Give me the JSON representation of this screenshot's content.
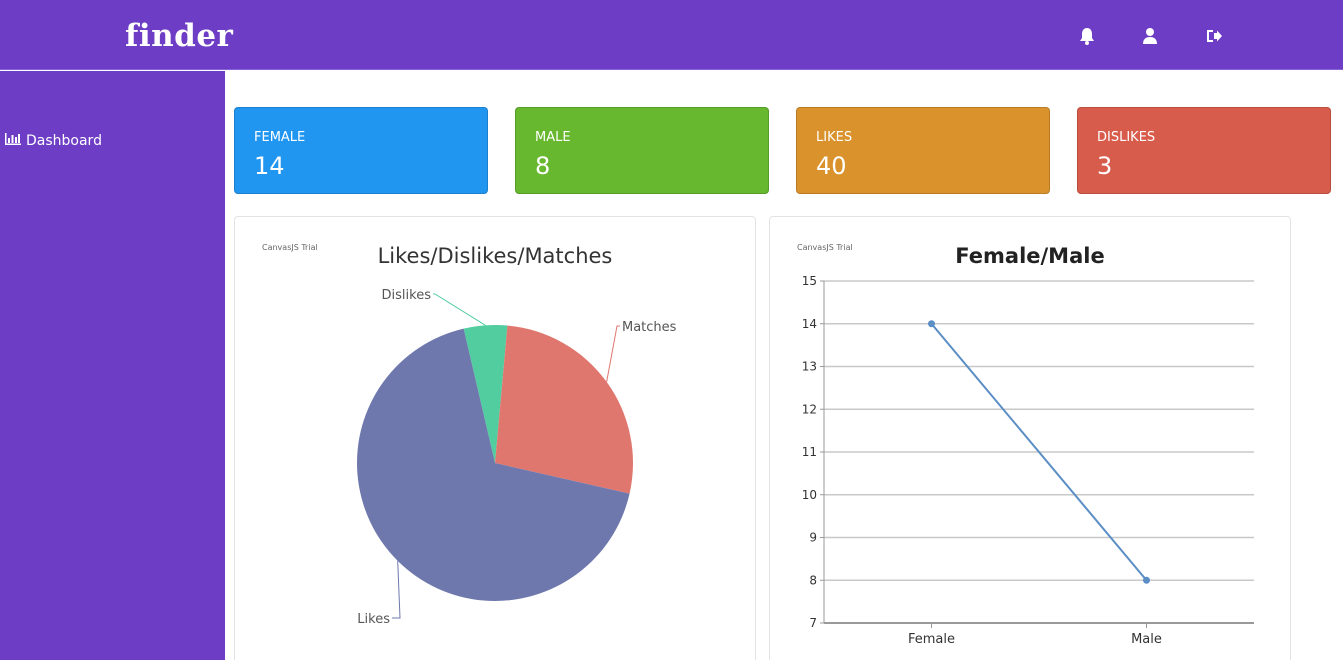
{
  "header": {
    "logo": "finder",
    "icons": [
      "bell-icon",
      "user-icon",
      "logout-icon"
    ]
  },
  "sidebar": {
    "items": [
      {
        "label": "Dashboard",
        "icon": "bar-chart-icon"
      }
    ]
  },
  "stats": [
    {
      "label": "FEMALE",
      "value": "14",
      "color": "#2196f0"
    },
    {
      "label": "MALE",
      "value": "8",
      "color": "#67b72f"
    },
    {
      "label": "LIKES",
      "value": "40",
      "color": "#da922c"
    },
    {
      "label": "DISLIKES",
      "value": "3",
      "color": "#d85c4b"
    }
  ],
  "pie_panel": {
    "watermark": "CanvasJS Trial"
  },
  "line_panel": {
    "watermark": "CanvasJS Trial"
  },
  "chart_data": [
    {
      "type": "pie",
      "title": "Likes/Dislikes/Matches",
      "slices": [
        {
          "label": "Likes",
          "value": 40,
          "color": "#6e78ad"
        },
        {
          "label": "Dislikes",
          "value": 3,
          "color": "#52cd9f"
        },
        {
          "label": "Matches",
          "value": 16,
          "color": "#e0776f"
        }
      ]
    },
    {
      "type": "line",
      "title": "Female/Male",
      "categories": [
        "Female",
        "Male"
      ],
      "series": [
        {
          "values": [
            14,
            8
          ],
          "color": "#5b8ec4"
        }
      ],
      "ylim": [
        7,
        15
      ],
      "yticks": [
        7,
        8,
        9,
        10,
        11,
        12,
        13,
        14,
        15
      ],
      "grid": true
    }
  ]
}
